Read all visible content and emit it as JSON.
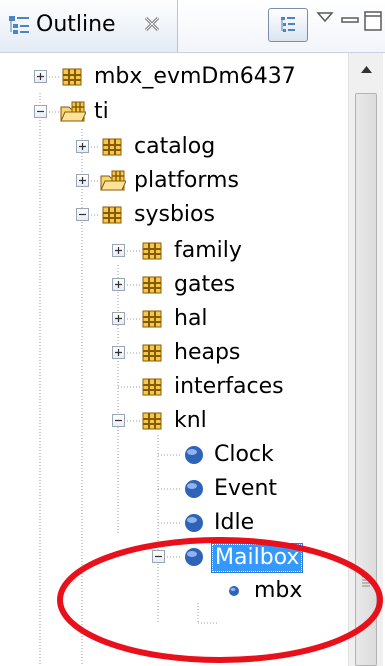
{
  "header": {
    "tab_label": "Outline",
    "tab_icon": "outline-icon",
    "close_icon": "close-icon",
    "collapse_icon": "collapse-all-icon",
    "view_menu_icon": "view-menu-icon",
    "minimize_icon": "minimize-icon",
    "maximize_icon": "maximize-icon"
  },
  "tree": {
    "items": [
      {
        "label": "mbx_evmDm6437",
        "icon": "package-icon",
        "expander": "plus"
      },
      {
        "label": "ti",
        "icon": "package-folder-icon",
        "expander": "minus"
      },
      {
        "label": "catalog",
        "icon": "package-icon",
        "expander": "plus"
      },
      {
        "label": "platforms",
        "icon": "package-folder-icon",
        "expander": "plus"
      },
      {
        "label": "sysbios",
        "icon": "package-icon",
        "expander": "minus"
      },
      {
        "label": "family",
        "icon": "package-icon",
        "expander": "plus"
      },
      {
        "label": "gates",
        "icon": "package-icon",
        "expander": "plus"
      },
      {
        "label": "hal",
        "icon": "package-icon",
        "expander": "plus"
      },
      {
        "label": "heaps",
        "icon": "package-icon",
        "expander": "plus"
      },
      {
        "label": "interfaces",
        "icon": "package-icon",
        "expander": "none"
      },
      {
        "label": "knl",
        "icon": "package-icon",
        "expander": "minus"
      },
      {
        "label": "Clock",
        "icon": "module-icon",
        "expander": "none"
      },
      {
        "label": "Event",
        "icon": "module-icon",
        "expander": "none"
      },
      {
        "label": "Idle",
        "icon": "module-icon",
        "expander": "none"
      },
      {
        "label": "Mailbox",
        "icon": "module-icon",
        "expander": "minus",
        "selected": true
      },
      {
        "label": "mbx",
        "icon": "instance-icon",
        "expander": "none"
      }
    ]
  },
  "colors": {
    "selection": "#3399ff",
    "annotation": "#e8101a",
    "package": "#b8860b",
    "module": "#2f63b8"
  }
}
